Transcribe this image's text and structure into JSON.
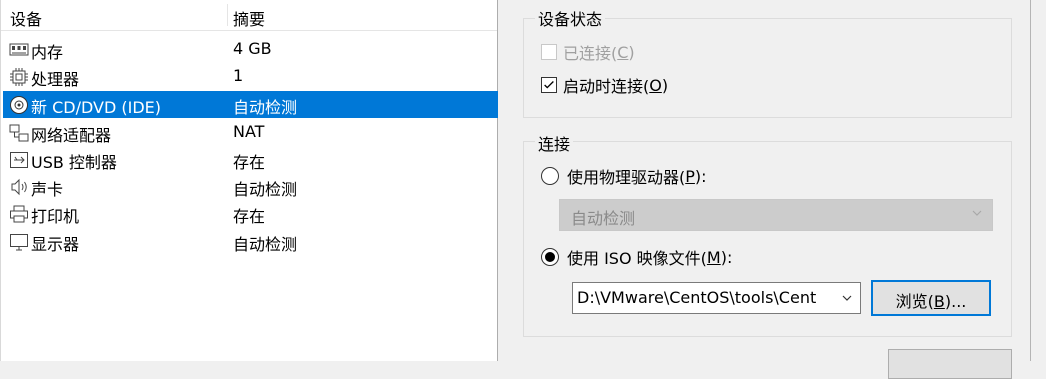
{
  "device_list": {
    "col_device": "设备",
    "col_summary": "摘要",
    "rows": [
      {
        "name": "内存",
        "summary": "4 GB",
        "icon": "memory-icon"
      },
      {
        "name": "处理器",
        "summary": "1",
        "icon": "processor-icon"
      },
      {
        "name": "新 CD/DVD (IDE)",
        "summary": "自动检测",
        "icon": "cd-dvd-icon"
      },
      {
        "name": "网络适配器",
        "summary": "NAT",
        "icon": "network-adapter-icon"
      },
      {
        "name": "USB 控制器",
        "summary": "存在",
        "icon": "usb-icon"
      },
      {
        "name": "声卡",
        "summary": "自动检测",
        "icon": "speaker-icon"
      },
      {
        "name": "打印机",
        "summary": "存在",
        "icon": "printer-icon"
      },
      {
        "name": "显示器",
        "summary": "自动检测",
        "icon": "monitor-icon"
      }
    ],
    "selected_index": 2
  },
  "device_status": {
    "title": "设备状态",
    "connected": {
      "text": "已连接(",
      "key": "C",
      "end": ")",
      "checked": false,
      "enabled": false
    },
    "connect_on_power": {
      "text": "启动时连接(",
      "key": "O",
      "end": ")",
      "checked": true
    }
  },
  "connection": {
    "title": "连接",
    "physical": {
      "text": "使用物理驱动器(",
      "key": "P",
      "end": "):",
      "selected": false
    },
    "physical_value": "自动检测",
    "iso": {
      "text": "使用 ISO 映像文件(",
      "key": "M",
      "end": "):",
      "selected": true
    },
    "iso_path": "D:\\VMware\\CentOS\\tools\\Cent",
    "browse": {
      "text": "浏览(",
      "key": "B",
      "end": ")..."
    }
  },
  "colors": {
    "selection": "#0078d7",
    "panel_bg": "#f0f0f0"
  }
}
